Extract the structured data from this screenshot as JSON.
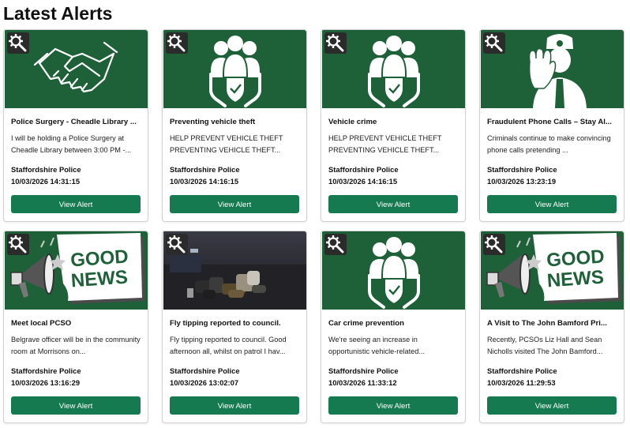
{
  "page": {
    "title": "Latest Alerts"
  },
  "colors": {
    "card_header_bg": "#1e6138",
    "button_bg": "#157a4f",
    "badge_bg": "#2b2b2b"
  },
  "cards": [
    {
      "image": "handshake-icon",
      "title": "Police Surgery - Cheadle Library ...",
      "summary": "I will be holding a Police Surgery at Cheadle Library between 3:00 PM -...",
      "source": "Staffordshire Police",
      "datetime": "10/03/2026 14:31:15",
      "button": "View Alert"
    },
    {
      "image": "protected-community-icon",
      "title": "Preventing vehicle theft",
      "summary": "HELP PREVENT VEHICLE THEFT PREVENTING VEHICLE THEFT...",
      "source": "Staffordshire Police",
      "datetime": "10/03/2026 14:16:15",
      "button": "View Alert"
    },
    {
      "image": "protected-community-icon",
      "title": "Vehicle crime",
      "summary": "HELP PREVENT VEHICLE THEFT PREVENTING VEHICLE THEFT...",
      "source": "Staffordshire Police",
      "datetime": "10/03/2026 14:16:15",
      "button": "View Alert"
    },
    {
      "image": "police-officer-stop-icon",
      "title": "Fraudulent Phone Calls – Stay Al...",
      "summary": "Criminals continue to make convincing phone calls pretending ...",
      "source": "Staffordshire Police",
      "datetime": "10/03/2026 13:23:19",
      "button": "View Alert"
    },
    {
      "image": "good-news-megaphone",
      "image_text": "GOOD NEWS",
      "title": "Meet local PCSO",
      "summary": "Belgrave officer will be in the community room at Morrisons on...",
      "source": "Staffordshire Police",
      "datetime": "10/03/2026 13:16:29",
      "button": "View Alert"
    },
    {
      "image": "fly-tipping-photo",
      "title": "Fly tipping reported to council.",
      "summary": "Fly tipping reported to council. Good afternoon all, whilst on patrol I hav...",
      "source": "Staffordshire Police",
      "datetime": "10/03/2026 13:02:07",
      "button": "View Alert"
    },
    {
      "image": "protected-community-icon",
      "title": "Car crime prevention",
      "summary": "We're seeing an increase in opportunistic vehicle-related...",
      "source": "Staffordshire Police",
      "datetime": "10/03/2026 11:33:12",
      "button": "View Alert"
    },
    {
      "image": "good-news-megaphone",
      "image_text": "GOOD NEWS",
      "title": "A Visit to The John Bamford Pri...",
      "summary": "Recently, PCSOs Liz Hall and Sean Nicholls visited The John Bamford...",
      "source": "Staffordshire Police",
      "datetime": "10/03/2026 11:29:53",
      "button": "View Alert"
    }
  ]
}
